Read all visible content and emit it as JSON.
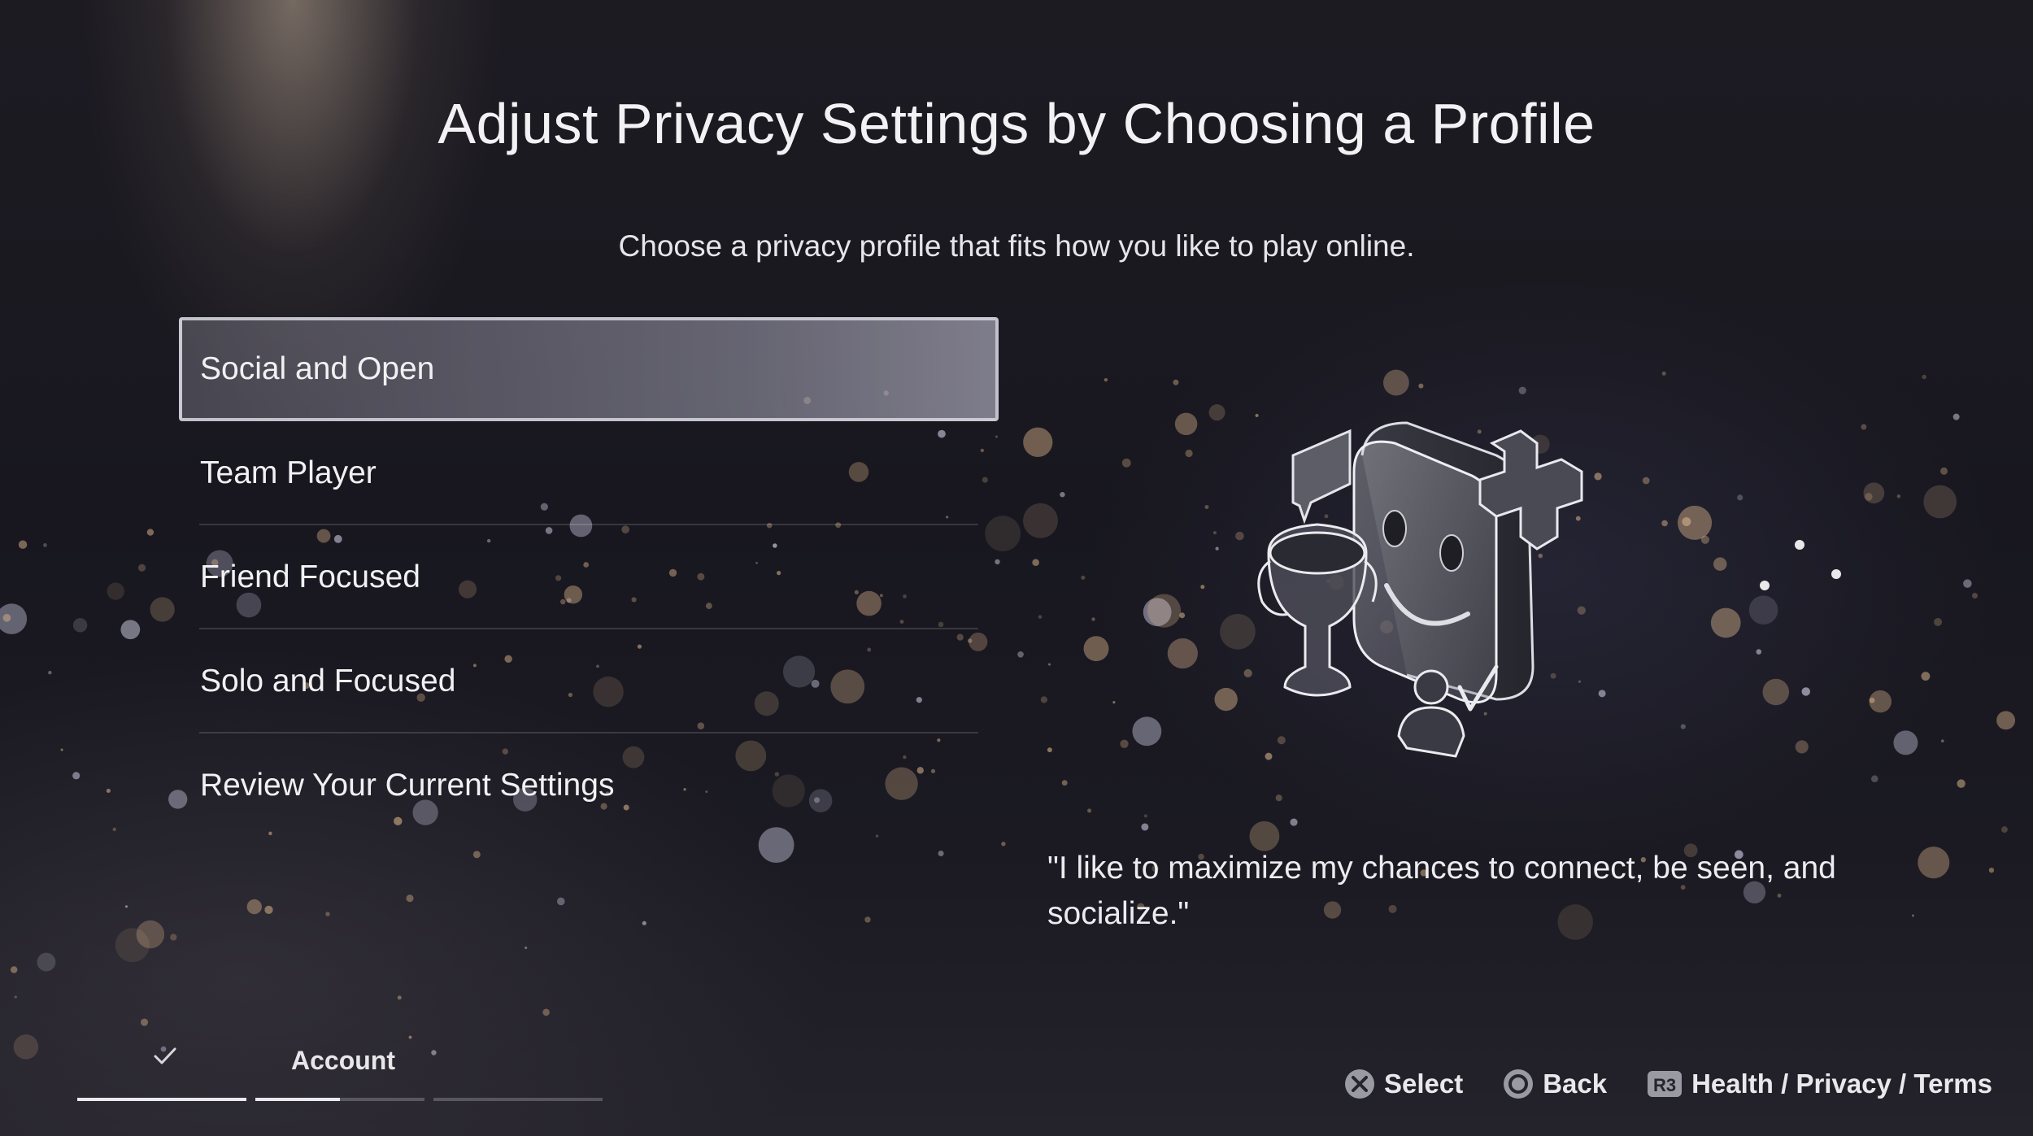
{
  "page": {
    "title": "Adjust Privacy Settings by Choosing a Profile",
    "subtitle": "Choose a privacy profile that fits how you like to play online."
  },
  "profiles": {
    "selected_index": 0,
    "items": [
      {
        "label": "Social and Open"
      },
      {
        "label": "Team Player"
      },
      {
        "label": "Friend Focused"
      },
      {
        "label": "Solo and Focused"
      },
      {
        "label": "Review Your Current Settings"
      }
    ]
  },
  "description": {
    "quote": "\"I like to maximize my chances to connect, be seen, and socialize.\"",
    "illustration_icon": "social-profile-illustration-icon"
  },
  "setup_progress": {
    "completed_step_icon": "checkmark-icon",
    "current_step_label": "Account",
    "steps": [
      {
        "fill": 1.0
      },
      {
        "fill": 0.5
      },
      {
        "fill": 0.0
      }
    ]
  },
  "controller_hints": {
    "select": {
      "icon": "cross-button-icon",
      "label": "Select"
    },
    "back": {
      "icon": "circle-button-icon",
      "label": "Back"
    },
    "health": {
      "icon": "r3-button-icon",
      "label": "Health / Privacy / Terms"
    }
  },
  "colors": {
    "background": "#1b1a22",
    "selected_item_border": "#d7d7e1",
    "text": "#f1f1f3"
  }
}
